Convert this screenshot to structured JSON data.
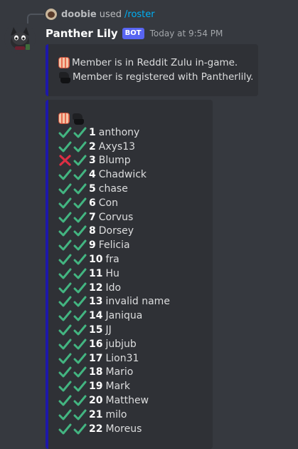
{
  "reply": {
    "username": "doobie",
    "used_text": "used",
    "command": "/roster"
  },
  "message": {
    "author": "Panther Lily",
    "badge": "BOT",
    "timestamp": "Today at 9:54 PM"
  },
  "legend": [
    {
      "icon": "reddit-zulu-icon",
      "text": "Member is in Reddit Zulu in-game."
    },
    {
      "icon": "pantherlily-icon",
      "text": "Member is registered with Pantherlily."
    }
  ],
  "roster_header_icons": [
    "reddit-zulu-icon",
    "pantherlily-icon"
  ],
  "roster": [
    {
      "num": "1",
      "name": "anthony",
      "in_game": true,
      "registered": true
    },
    {
      "num": "2",
      "name": "Axys13",
      "in_game": true,
      "registered": true
    },
    {
      "num": "3",
      "name": "Blump",
      "in_game": false,
      "registered": true
    },
    {
      "num": "4",
      "name": "Chadwick",
      "in_game": true,
      "registered": true
    },
    {
      "num": "5",
      "name": "chase",
      "in_game": true,
      "registered": true
    },
    {
      "num": "6",
      "name": "Con",
      "in_game": true,
      "registered": true
    },
    {
      "num": "7",
      "name": "Corvus",
      "in_game": true,
      "registered": true
    },
    {
      "num": "8",
      "name": "Dorsey",
      "in_game": true,
      "registered": true
    },
    {
      "num": "9",
      "name": "Felicia",
      "in_game": true,
      "registered": true
    },
    {
      "num": "10",
      "name": "fra",
      "in_game": true,
      "registered": true
    },
    {
      "num": "11",
      "name": "Hu",
      "in_game": true,
      "registered": true
    },
    {
      "num": "12",
      "name": "Ido",
      "in_game": true,
      "registered": true
    },
    {
      "num": "13",
      "name": "invalid name",
      "in_game": true,
      "registered": true
    },
    {
      "num": "14",
      "name": "Janiqua",
      "in_game": true,
      "registered": true
    },
    {
      "num": "15",
      "name": "JJ",
      "in_game": true,
      "registered": true
    },
    {
      "num": "16",
      "name": "jubjub",
      "in_game": true,
      "registered": true
    },
    {
      "num": "17",
      "name": "Lion31",
      "in_game": true,
      "registered": true
    },
    {
      "num": "18",
      "name": "Mario",
      "in_game": true,
      "registered": true
    },
    {
      "num": "19",
      "name": "Mark",
      "in_game": true,
      "registered": true
    },
    {
      "num": "20",
      "name": "Matthew",
      "in_game": true,
      "registered": true
    },
    {
      "num": "21",
      "name": "milo",
      "in_game": true,
      "registered": true
    },
    {
      "num": "22",
      "name": "Moreus",
      "in_game": true,
      "registered": true
    }
  ],
  "colors": {
    "background": "#36393f",
    "embed_background": "#2f3136",
    "embed_border": "#1d17a8",
    "check": "#43b581",
    "cross": "#dd2e44",
    "bot_badge": "#5865f2",
    "command_link": "#00aff4"
  }
}
